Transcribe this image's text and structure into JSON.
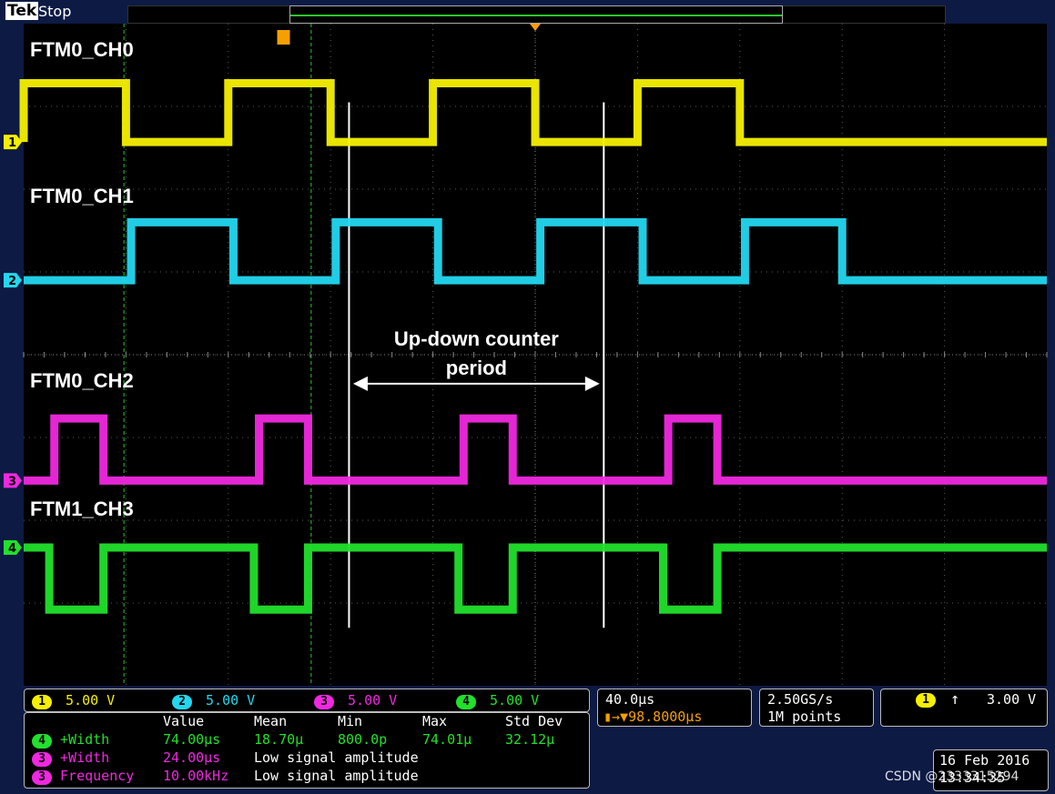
{
  "status": {
    "brand": "Tek",
    "run_state": "Stop"
  },
  "colors": {
    "ch1": "#f5f000",
    "ch2": "#22d8f0",
    "ch3": "#f028e0",
    "ch4": "#22e02c",
    "background": "#000000",
    "grid": "#5a5a5a"
  },
  "chart_data": {
    "type": "line",
    "title": "",
    "annotation": {
      "line1": "Up-down counter",
      "line2": "period"
    },
    "time_per_div_us": 40.0,
    "x_divisions": 10,
    "y_divisions": 8,
    "series": [
      {
        "name": "FTM0_CH0",
        "channel": "1",
        "color": "#f5f000",
        "high_intervals_div": [
          [
            0.0,
            1.0
          ],
          [
            2.0,
            3.0
          ],
          [
            4.0,
            5.0
          ],
          [
            6.0,
            7.0
          ]
        ]
      },
      {
        "name": "FTM0_CH1",
        "channel": "2",
        "color": "#22d8f0",
        "high_intervals_div": [
          [
            1.05,
            2.05
          ],
          [
            3.05,
            4.05
          ],
          [
            5.05,
            6.05
          ],
          [
            7.05,
            8.0
          ]
        ]
      },
      {
        "name": "FTM0_CH2",
        "channel": "3",
        "color": "#f028e0",
        "high_intervals_div": [
          [
            0.3,
            0.78
          ],
          [
            2.3,
            2.78
          ],
          [
            4.3,
            4.78
          ],
          [
            6.3,
            6.78
          ]
        ]
      },
      {
        "name": "FTM1_CH3",
        "channel": "4",
        "color": "#22e02c",
        "low_intervals_div": [
          [
            0.25,
            0.78
          ],
          [
            2.25,
            2.78
          ],
          [
            4.25,
            4.78
          ],
          [
            6.25,
            6.78
          ]
        ]
      }
    ]
  },
  "channel_scales": [
    {
      "num": "1",
      "value": "5.00 V"
    },
    {
      "num": "2",
      "value": "5.00 V"
    },
    {
      "num": "3",
      "value": "5.00 V"
    },
    {
      "num": "4",
      "value": "5.00 V"
    }
  ],
  "timebase": {
    "scale": "40.0μs",
    "position": "98.8000μs"
  },
  "acquisition": {
    "rate": "2.50GS/s",
    "points": "1M points"
  },
  "trigger": {
    "channel": "1",
    "level": "3.00 V"
  },
  "measurements": {
    "headers": [
      "Value",
      "Mean",
      "Min",
      "Max",
      "Std Dev"
    ],
    "rows": [
      {
        "ch": "4",
        "name": "+Width",
        "value": "74.00μs",
        "mean": "18.70μ",
        "min": "800.0p",
        "max": "74.01μ",
        "std": "32.12μ"
      },
      {
        "ch": "3",
        "name": "+Width",
        "value": "24.00μs",
        "note": "Low signal amplitude"
      },
      {
        "ch": "3",
        "name": "Frequency",
        "value": "10.00kHz",
        "note": "Low signal amplitude"
      }
    ]
  },
  "date": {
    "date": "16 Feb 2016",
    "time": "13:34:35"
  },
  "watermark": "CSDN @2333315294"
}
